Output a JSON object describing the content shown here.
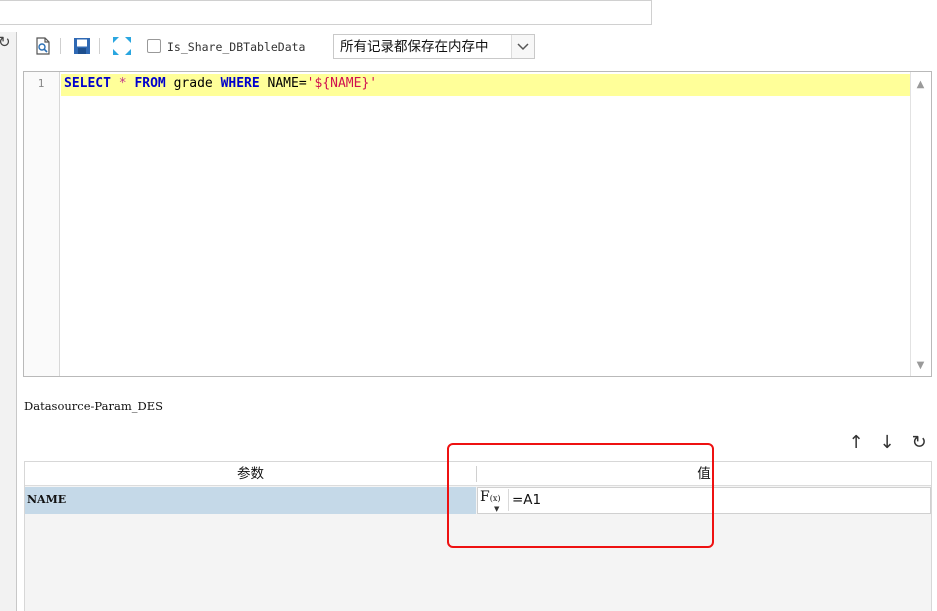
{
  "dataset_name_value": "",
  "toolbar": {
    "refresh_icon": "refresh-icon",
    "preview_icon": "preview-icon",
    "save_icon": "save-icon",
    "expand_icon": "expand-icon",
    "share_checkbox_label": "Is_Share_DBTableData",
    "share_checked": false,
    "storage_mode_selected": "所有记录都保存在内存中"
  },
  "editor": {
    "line_number": "1",
    "sql_tokens": {
      "select": "SELECT",
      "star": " * ",
      "from": "FROM",
      "table": " grade ",
      "where": "WHERE",
      "cond": " NAME=",
      "param": "'${NAME}'"
    },
    "highlight_color": "#ffff99"
  },
  "datasource_label": "Datasource-Param_DES",
  "param_toolbar": {
    "up_icon": "arrow-up-icon",
    "down_icon": "arrow-down-icon",
    "refresh_icon": "refresh-icon"
  },
  "param_table": {
    "headers": [
      "参数",
      "值"
    ],
    "rows": [
      {
        "name": "NAME",
        "value": "=A1"
      }
    ],
    "selected_row_color": "#c5d9e8"
  },
  "annotation": {
    "color": "#ee1111"
  }
}
